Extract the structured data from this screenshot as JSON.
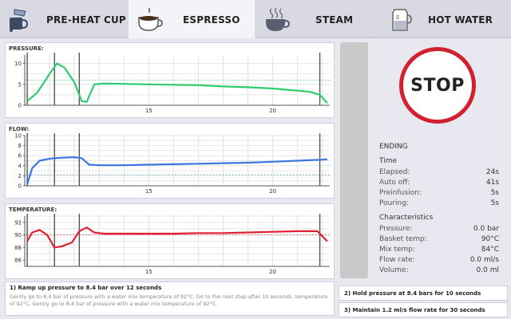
{
  "tabs": [
    {
      "label": "PRE-HEAT CUP",
      "icon": "cup-pour-icon",
      "active": false
    },
    {
      "label": "ESPRESSO",
      "icon": "espresso-cup-icon",
      "active": true
    },
    {
      "label": "STEAM",
      "icon": "steam-cup-icon",
      "active": false
    },
    {
      "label": "HOT WATER",
      "icon": "water-jug-icon",
      "active": false
    }
  ],
  "charts": {
    "pressure": {
      "label": "PRESSURE:"
    },
    "flow": {
      "label": "FLOW:"
    },
    "temperature": {
      "label": "TEMPERATURE:"
    }
  },
  "chart_data": [
    {
      "type": "line",
      "title": "PRESSURE:",
      "xlim": [
        10,
        22.3
      ],
      "ylim": [
        0,
        12
      ],
      "yticks": [
        0,
        5,
        10
      ],
      "xticks": [
        15,
        20
      ],
      "markers_x": [
        10.1,
        11.2,
        12.2,
        21.9
      ],
      "target": 6,
      "color": "#2dcc70",
      "x": [
        10.1,
        10.5,
        11.0,
        11.3,
        11.6,
        12.0,
        12.3,
        12.5,
        12.8,
        13.2,
        14.0,
        15.0,
        16.0,
        17.0,
        18.0,
        19.0,
        20.0,
        21.0,
        21.5,
        21.9,
        22.2
      ],
      "y": [
        1.0,
        3.0,
        7.5,
        10.0,
        9.0,
        5.5,
        1.0,
        0.8,
        5.0,
        5.2,
        5.1,
        5.0,
        4.9,
        4.8,
        4.5,
        4.3,
        4.0,
        3.5,
        3.2,
        2.5,
        0.5
      ]
    },
    {
      "type": "line",
      "title": "FLOW:",
      "xlim": [
        10,
        22.3
      ],
      "ylim": [
        0,
        10
      ],
      "yticks": [
        0,
        2,
        4,
        6,
        8,
        10
      ],
      "xticks": [
        15,
        20
      ],
      "markers_x": [
        10.1,
        11.2,
        12.2,
        21.9
      ],
      "target": 2.2,
      "color": "#3a78e0",
      "x": [
        10.1,
        10.3,
        10.6,
        11.0,
        11.5,
        12.0,
        12.3,
        12.6,
        13.0,
        14.0,
        15.0,
        16.0,
        17.0,
        18.0,
        19.0,
        20.0,
        21.0,
        22.0,
        22.2
      ],
      "y": [
        0.3,
        3.5,
        5.0,
        5.4,
        5.6,
        5.7,
        5.5,
        4.2,
        4.1,
        4.1,
        4.2,
        4.3,
        4.4,
        4.5,
        4.6,
        4.8,
        5.0,
        5.2,
        5.3
      ]
    },
    {
      "type": "line",
      "title": "TEMPERATURE:",
      "xlim": [
        10,
        22.3
      ],
      "ylim": [
        85,
        93
      ],
      "yticks": [
        86,
        88,
        90,
        92
      ],
      "xticks": [
        15,
        20
      ],
      "markers_x": [
        10.1,
        11.2,
        12.2,
        21.9
      ],
      "target": 90,
      "color": "#e0202e",
      "x": [
        10.1,
        10.3,
        10.6,
        10.9,
        11.2,
        11.5,
        11.9,
        12.2,
        12.5,
        12.8,
        13.2,
        14.0,
        15.0,
        16.0,
        17.0,
        18.0,
        19.0,
        20.0,
        21.0,
        21.8,
        22.2
      ],
      "y": [
        89.0,
        90.4,
        90.8,
        90.0,
        88.0,
        88.2,
        88.8,
        90.6,
        91.2,
        90.4,
        90.2,
        90.2,
        90.2,
        90.2,
        90.3,
        90.3,
        90.4,
        90.5,
        90.6,
        90.6,
        89.0
      ]
    }
  ],
  "stop_label": "STOP",
  "status": {
    "heading": "ENDING",
    "time_heading": "Time",
    "time_rows": [
      {
        "label": "Elapsed:",
        "value": "24s"
      },
      {
        "label": "Auto off:",
        "value": "41s"
      },
      {
        "label": "Preinfusion:",
        "value": "5s"
      },
      {
        "label": "Pouring:",
        "value": "5s"
      }
    ],
    "char_heading": "Characteristics",
    "char_rows": [
      {
        "label": "Pressure:",
        "value": "0.0 bar"
      },
      {
        "label": "Basket temp:",
        "value": "90°C"
      },
      {
        "label": "Mix temp:",
        "value": "84°C"
      },
      {
        "label": "Flow rate:",
        "value": "0.0 ml/s"
      },
      {
        "label": "Volume:",
        "value": "0.0 ml"
      }
    ]
  },
  "steps": {
    "step1_title": "1) Ramp up pressure to 8.4 bar over 12 seconds",
    "step1_body": "Gently go to 8.4 bar of pressure with a water mix temperature of 92°C. Go to the next step after 10 seconds. temperature of 92°C. Gently go to 8.4 bar of pressure with a water mix temperature of 92°C.",
    "step2_title": "2) Hold pressure at 8.4 bars for 10 seconds",
    "step3_title": "3) Maintain 1.2 ml/s flow rate for 30 seconds"
  }
}
